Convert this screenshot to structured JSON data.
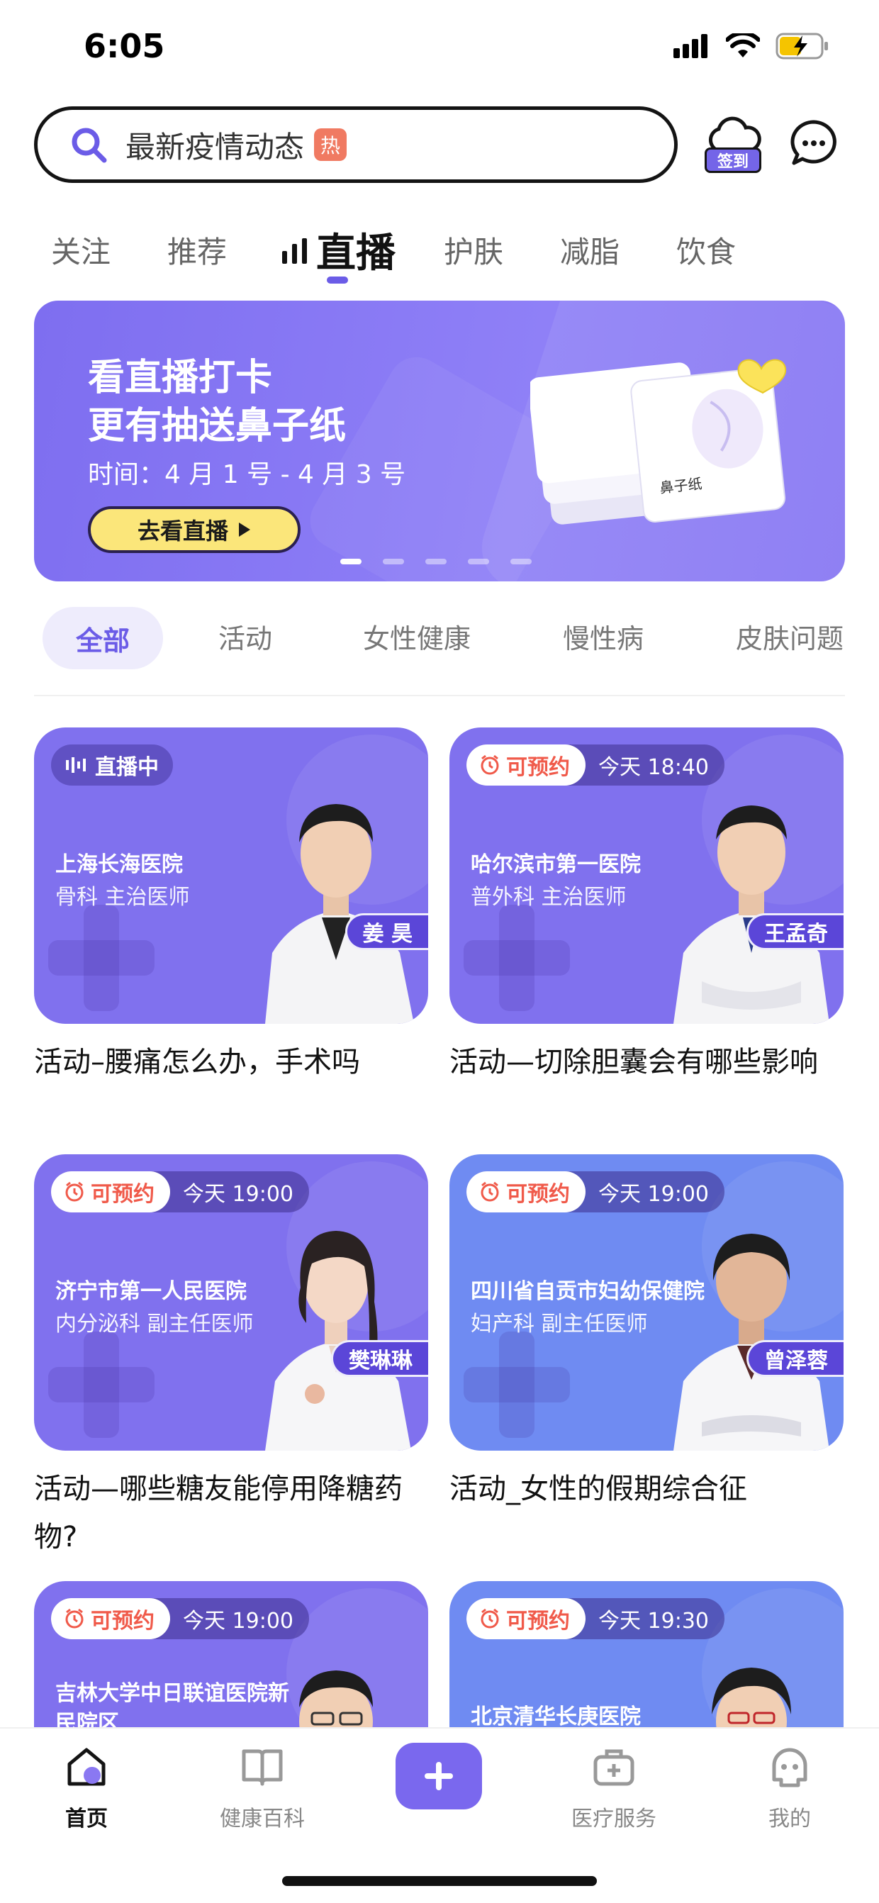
{
  "status_bar": {
    "time": "6:05"
  },
  "search": {
    "text": "最新疫情动态",
    "hot_badge": "热",
    "checkin_label": "签到"
  },
  "category_tabs": [
    "关注",
    "推荐",
    "直播",
    "护肤",
    "减脂",
    "饮食"
  ],
  "active_category": "直播",
  "banner": {
    "title_line1": "看直播打卡",
    "title_line2": "更有抽送鼻子纸",
    "time": "时间：4 月 1 号 - 4 月 3 号",
    "button": "去看直播",
    "product_label": "鼻子纸",
    "slide_count": 5,
    "active_slide": 1
  },
  "filters": [
    "全部",
    "活动",
    "女性健康",
    "慢性病",
    "皮肤问题"
  ],
  "cards": [
    {
      "status": "直播中",
      "time": "",
      "hospital": "上海长海医院",
      "dept": "骨科 主治医师",
      "doctor": "姜 昊",
      "title": "活动–腰痛怎么办，手术吗",
      "color": "purple"
    },
    {
      "status": "可预约",
      "time": "今天 18:40",
      "hospital": "哈尔滨市第一医院",
      "dept": "普外科 主治医师",
      "doctor": "王孟奇",
      "title": "活动—切除胆囊会有哪些影响",
      "color": "purple"
    },
    {
      "status": "可预约",
      "time": "今天 19:00",
      "hospital": "济宁市第一人民医院",
      "dept": "内分泌科 副主任医师",
      "doctor": "樊琳琳",
      "title": "活动—哪些糖友能停用降糖药物?",
      "color": "purple"
    },
    {
      "status": "可预约",
      "time": "今天 19:00",
      "hospital": "四川省自贡市妇幼保健院",
      "dept": "妇产科 副主任医师",
      "doctor": "曾泽蓉",
      "title": "活动_女性的假期综合征",
      "color": "blue"
    },
    {
      "status": "可预约",
      "time": "今天 19:00",
      "hospital": "吉林大学中日联谊医院新民院区",
      "dept": "",
      "doctor": "",
      "title": "",
      "color": "purple"
    },
    {
      "status": "可预约",
      "time": "今天 19:30",
      "hospital": "北京清华长庚医院",
      "dept": "",
      "doctor": "",
      "title": "",
      "color": "blue"
    }
  ],
  "bottom_nav": [
    "首页",
    "健康百科",
    "医疗服务",
    "我的"
  ],
  "colors": {
    "accent": "#6b5ce7",
    "banner": "#8473f2",
    "card_purple": "#8071ee",
    "card_blue": "#6f8bf2",
    "badge_yellow": "#fbe67a"
  }
}
